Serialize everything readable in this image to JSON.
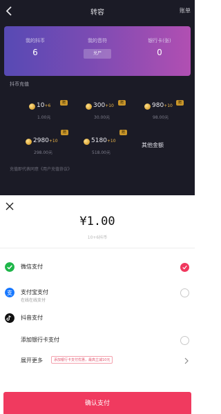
{
  "nav": {
    "title": "转容",
    "right_label": "账单"
  },
  "banner": {
    "stats": [
      {
        "label": "我的抖币",
        "value": "6"
      },
      {
        "label": "我的音符",
        "button": "兑尸"
      },
      {
        "label": "银行卡(张)",
        "value": "0"
      }
    ]
  },
  "recharge": {
    "section_label": "抖币充值",
    "packages": [
      {
        "amount": "10",
        "bonus": "+6",
        "price": "1.00元",
        "tag": "赠"
      },
      {
        "amount": "300",
        "bonus": "+10",
        "price": "30.00元",
        "tag": "赠"
      },
      {
        "amount": "980",
        "bonus": "+10",
        "price": "98.00元",
        "tag": "赠"
      },
      {
        "amount": "2980",
        "bonus": "+10",
        "price": "298.00元",
        "tag": "赠"
      },
      {
        "amount": "5180",
        "bonus": "+10",
        "price": "518.00元",
        "tag": "赠"
      }
    ],
    "other_amount": "其他金额",
    "notice": "充值即代表同意《用户充值协议》"
  },
  "payment": {
    "amount": "¥1.00",
    "sub": "10+6抖币",
    "options": [
      {
        "name": "微信支付",
        "icon": "wechat-icon",
        "selected": true
      },
      {
        "name": "支付宝支付",
        "note": "在线在线支付",
        "icon": "alipay-icon",
        "selected": false
      },
      {
        "name": "抖音支付",
        "icon": "douyin-icon"
      },
      {
        "name": "添加银行卡支付",
        "selected": false
      }
    ],
    "promo": {
      "label": "展开更多",
      "tag": "添加银行卡支付优惠，最高立减10元"
    },
    "confirm": "确认支付"
  },
  "colors": {
    "accent": "#f03a5f",
    "banner_start": "#574ab4",
    "banner_end": "#b14fb2",
    "dark_bg": "#1b1b26"
  }
}
